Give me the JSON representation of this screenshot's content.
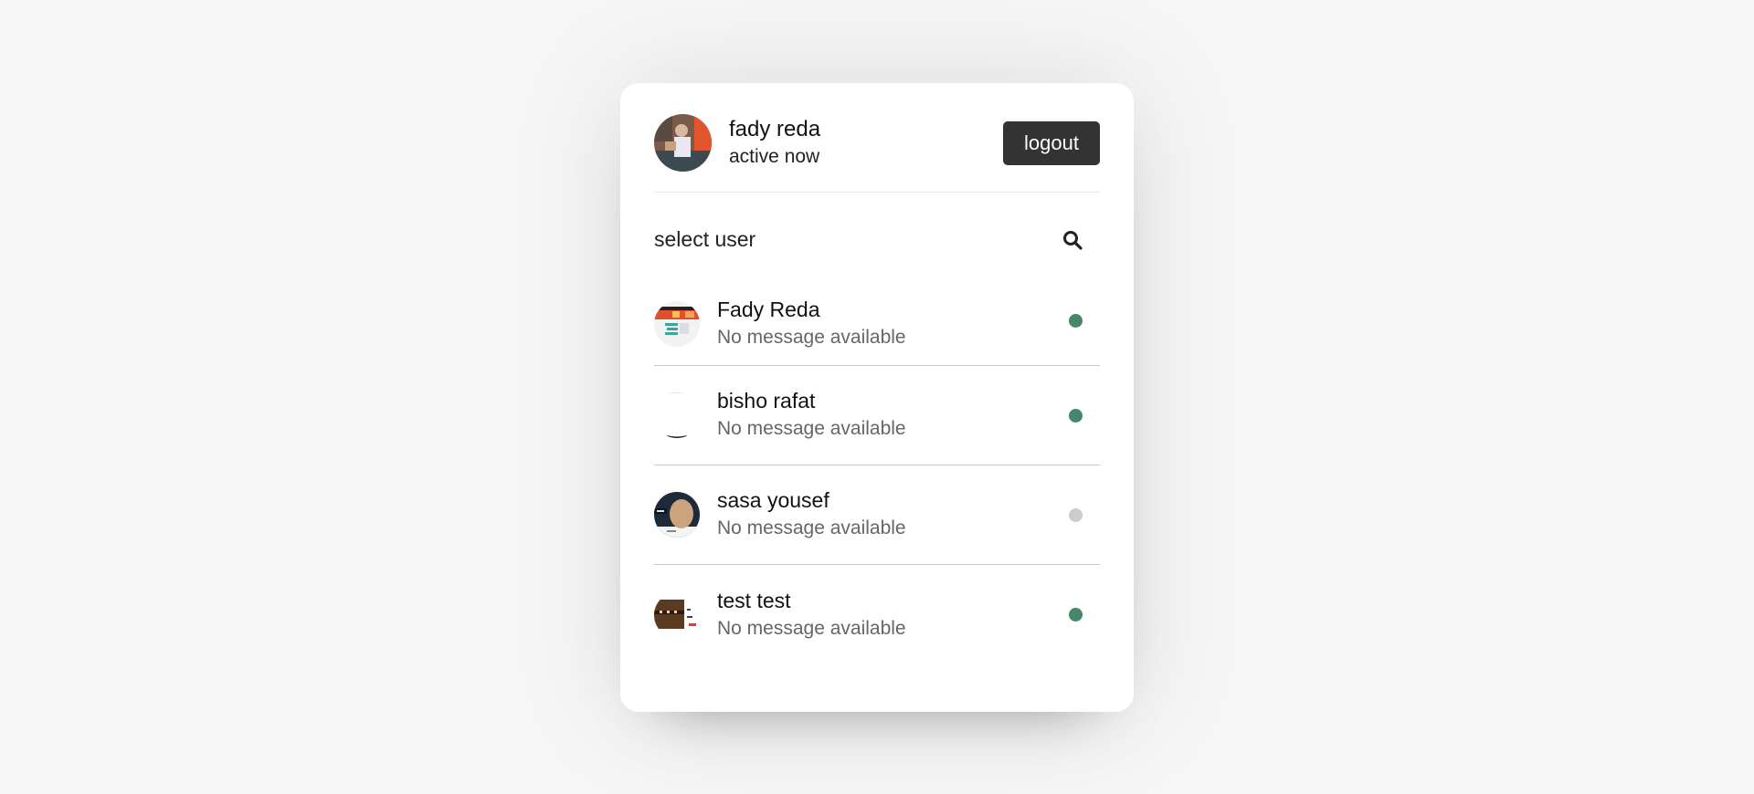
{
  "current_user": {
    "name": "fady reda",
    "status": "active now"
  },
  "logout_label": "logout",
  "search": {
    "label": "select user",
    "icon": "search-icon"
  },
  "users": [
    {
      "name": "Fady Reda",
      "message": "No message available",
      "online": true
    },
    {
      "name": "bisho rafat",
      "message": "No message available",
      "online": true
    },
    {
      "name": "sasa yousef",
      "message": "No message available",
      "online": false
    },
    {
      "name": "test test",
      "message": "No message available",
      "online": true
    }
  ],
  "colors": {
    "online": "#468669",
    "offline": "#cccccc",
    "button_bg": "#333333"
  }
}
